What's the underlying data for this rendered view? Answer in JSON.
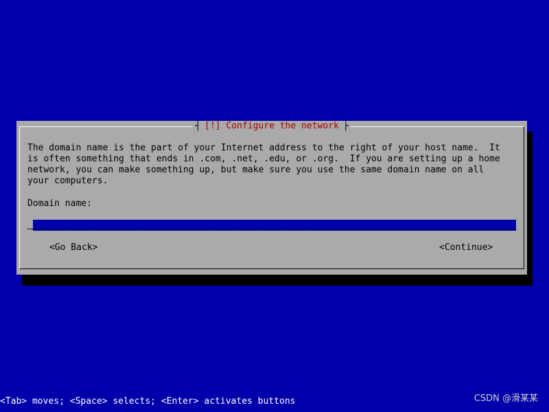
{
  "dialog": {
    "title": "[!] Configure the network",
    "description": "The domain name is the part of your Internet address to the right of your host name.  It\nis often something that ends in .com, .net, .edu, or .org.  If you are setting up a home\nnetwork, you can make something up, but make sure you use the same domain name on all\nyour computers.",
    "field_label": "Domain name:",
    "field_value": "",
    "cursor": "_",
    "back_label": "<Go Back>",
    "continue_label": "<Continue>"
  },
  "footer": {
    "help": "<Tab> moves; <Space> selects; <Enter> activates buttons",
    "watermark": "CSDN @滑某某"
  },
  "colors": {
    "background": "#0000aa",
    "dialog": "#aaaaaa",
    "title": "#aa0000",
    "input": "#0000aa"
  }
}
